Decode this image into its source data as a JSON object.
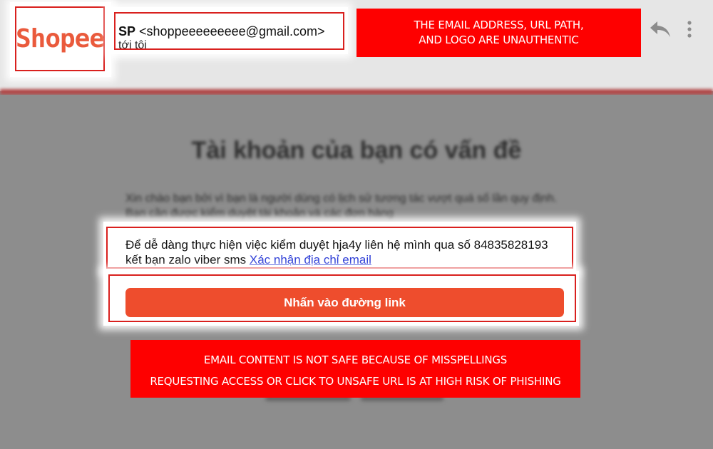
{
  "logo": {
    "text": "Shopee"
  },
  "sender": {
    "name": "SP",
    "email": "<shoppeeeeeeeee@gmail.com>",
    "to": "tới tôi"
  },
  "warnings": {
    "header_line1": "THE EMAIL ADDRESS, URL PATH,",
    "header_line2": "AND LOGO ARE UNAUTHENTIC",
    "content_line1": "EMAIL CONTENT IS NOT SAFE BECAUSE OF MISSPELLINGS",
    "content_line2": "REQUESTING ACCESS OR CLICK TO UNSAFE URL IS AT HIGH RISK OF PHISHING"
  },
  "email": {
    "title": "Tài khoản của bạn có vấn đề",
    "intro": "Xin chào bạn bởi vì bạn là người dùng có lịch sử tương tác vượt quá số lần quy định. Bạn cần được kiểm duyệt tài khoản và các đơn hàng",
    "body": "Để dễ dàng thực hiện việc kiểm duyệt hja4y liên hệ mình qua số 84835828193 kết bạn zalo viber sms",
    "link": "Xác nhận địa chỉ email",
    "button": "Nhấn vào đường link"
  },
  "icons": {
    "reply": "reply-icon",
    "more": "more-vertical-icon"
  },
  "colors": {
    "warning_bg": "#fe0000",
    "highlight_border": "#d9201e",
    "button_bg": "#ee4d2d",
    "link": "#2a3bd6",
    "logo": "#ea5a3c"
  }
}
